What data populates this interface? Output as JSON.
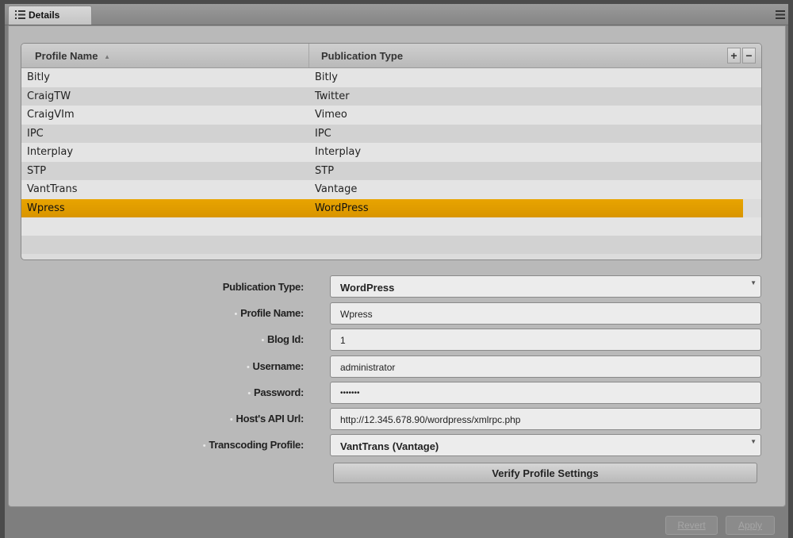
{
  "tab": {
    "label": "Details"
  },
  "grid": {
    "columns": [
      {
        "label": "Profile Name",
        "sort": "ascending"
      },
      {
        "label": "Publication Type"
      }
    ],
    "add_label": "+",
    "remove_label": "−",
    "rows": [
      {
        "name": "Bitly",
        "type": "Bitly"
      },
      {
        "name": "CraigTW",
        "type": "Twitter"
      },
      {
        "name": "CraigVIm",
        "type": "Vimeo"
      },
      {
        "name": "IPC",
        "type": "IPC"
      },
      {
        "name": "Interplay",
        "type": "Interplay"
      },
      {
        "name": "STP",
        "type": "STP"
      },
      {
        "name": "VantTrans",
        "type": "Vantage"
      },
      {
        "name": "Wpress",
        "type": "WordPress",
        "selected": true
      }
    ]
  },
  "form": {
    "publication_type": {
      "label": "Publication Type:",
      "value": "WordPress"
    },
    "profile_name": {
      "label": "Profile Name:",
      "value": "Wpress",
      "required": true
    },
    "blog_id": {
      "label": "Blog Id:",
      "value": "1",
      "required": true
    },
    "username": {
      "label": "Username:",
      "value": "administrator",
      "required": true
    },
    "password": {
      "label": "Password:",
      "value": "•••••••",
      "required": true
    },
    "host_api_url": {
      "label": "Host's API Url:",
      "value": "http://12.345.678.90/wordpress/xmlrpc.php",
      "required": true
    },
    "transcoding_profile": {
      "label": "Transcoding Profile:",
      "value": "VantTrans (Vantage)",
      "required": true
    },
    "required_marker": "•",
    "verify_label": "Verify Profile Settings"
  },
  "footer": {
    "revert_label": "Revert",
    "apply_label": "Apply"
  },
  "colors": {
    "selection": "#e0a000",
    "background": "#b9b9b9"
  }
}
